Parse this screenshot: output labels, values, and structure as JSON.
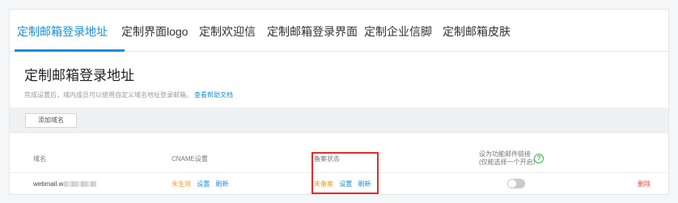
{
  "tabs": [
    {
      "label": "定制邮箱登录地址",
      "active": true
    },
    {
      "label": "定制界面logo",
      "active": false
    },
    {
      "label": "定制欢迎信",
      "active": false
    },
    {
      "label": "定制邮箱登录界面",
      "active": false
    },
    {
      "label": "定制企业信脚",
      "active": false
    },
    {
      "label": "定制邮箱皮肤",
      "active": false
    }
  ],
  "page": {
    "title": "定制邮箱登录地址",
    "description": "完成设置后，域内成员可以使用自定义域名地址登录邮箱。",
    "description_link": "查看帮助文档"
  },
  "toolbar": {
    "add_button": "添加域名"
  },
  "table": {
    "headers": {
      "domain": "域名",
      "cname": "CNAME设置",
      "record": "备案状态",
      "forward_line1": "设为功能邮件链接",
      "forward_line2": "(仅能选择一个开启)"
    },
    "help_icon": "help-icon",
    "rows": [
      {
        "domain": "webmail.w",
        "cname_status": "未生效",
        "cname_set": "设置",
        "cname_refresh": "刷新",
        "record_status": "未备案",
        "record_set": "设置",
        "record_refresh": "刷新",
        "forward_enabled": false,
        "delete": "删除"
      }
    ]
  },
  "colors": {
    "accent": "#1a8fd6",
    "warning": "#f39a1e",
    "danger": "#e0483c",
    "help": "#3bb44a",
    "highlight": "#e42b2b"
  }
}
